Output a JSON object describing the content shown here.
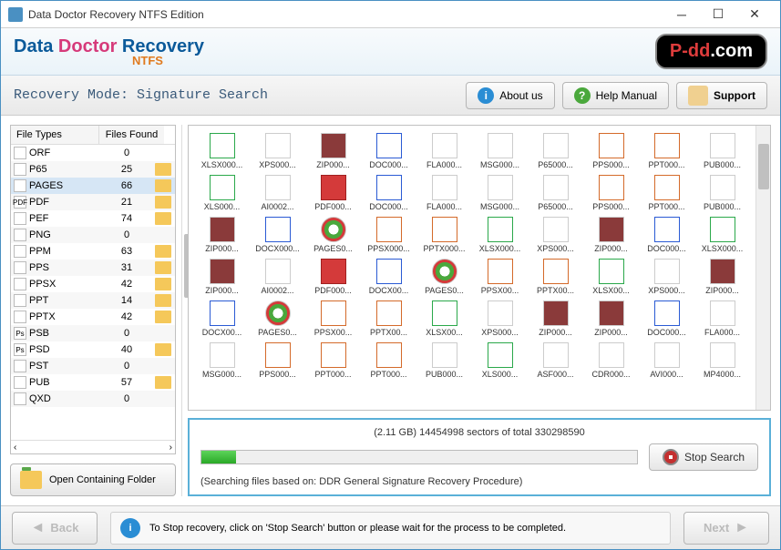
{
  "titlebar": {
    "text": "Data Doctor Recovery NTFS Edition"
  },
  "header": {
    "brand1": "Data ",
    "brand2": "Doctor",
    "brand3": " Recovery",
    "sub": "NTFS",
    "logo1": "P-dd",
    "logo2": ".com"
  },
  "modebar": {
    "mode": "Recovery Mode: Signature Search",
    "about": "About us",
    "help": "Help Manual",
    "support": "Support"
  },
  "types_header": {
    "name": "File Types",
    "count": "Files Found"
  },
  "types": [
    {
      "name": "ORF",
      "count": 0,
      "ic": "",
      "hasFolder": false
    },
    {
      "name": "P65",
      "count": 25,
      "ic": "",
      "hasFolder": true
    },
    {
      "name": "PAGES",
      "count": 66,
      "ic": "",
      "hasFolder": true,
      "sel": true
    },
    {
      "name": "PDF",
      "count": 21,
      "ic": "PDF",
      "hasFolder": true
    },
    {
      "name": "PEF",
      "count": 74,
      "ic": "",
      "hasFolder": true
    },
    {
      "name": "PNG",
      "count": 0,
      "ic": "",
      "hasFolder": false
    },
    {
      "name": "PPM",
      "count": 63,
      "ic": "",
      "hasFolder": true
    },
    {
      "name": "PPS",
      "count": 31,
      "ic": "",
      "hasFolder": true
    },
    {
      "name": "PPSX",
      "count": 42,
      "ic": "",
      "hasFolder": true
    },
    {
      "name": "PPT",
      "count": 14,
      "ic": "",
      "hasFolder": true
    },
    {
      "name": "PPTX",
      "count": 42,
      "ic": "",
      "hasFolder": true
    },
    {
      "name": "PSB",
      "count": 0,
      "ic": "Ps",
      "hasFolder": false
    },
    {
      "name": "PSD",
      "count": 40,
      "ic": "Ps",
      "hasFolder": true
    },
    {
      "name": "PST",
      "count": 0,
      "ic": "",
      "hasFolder": false
    },
    {
      "name": "PUB",
      "count": 57,
      "ic": "",
      "hasFolder": true
    },
    {
      "name": "QXD",
      "count": 0,
      "ic": "",
      "hasFolder": false
    }
  ],
  "open_btn": "Open Containing Folder",
  "files": [
    [
      {
        "l": "XLSX000...",
        "c": "c-xls"
      },
      {
        "l": "XPS000...",
        "c": "c-gen"
      },
      {
        "l": "ZIP000...",
        "c": "c-zip"
      },
      {
        "l": "DOC000...",
        "c": "c-doc"
      },
      {
        "l": "FLA000...",
        "c": "c-gen"
      },
      {
        "l": "MSG000...",
        "c": "c-gen"
      },
      {
        "l": "P65000...",
        "c": "c-gen"
      },
      {
        "l": "PPS000...",
        "c": "c-ppt"
      },
      {
        "l": "PPT000...",
        "c": "c-ppt"
      },
      {
        "l": "PUB000...",
        "c": "c-gen"
      }
    ],
    [
      {
        "l": "XLS000...",
        "c": "c-xls"
      },
      {
        "l": "AI0002...",
        "c": "c-gen"
      },
      {
        "l": "PDF000...",
        "c": "c-pdf"
      },
      {
        "l": "DOC000...",
        "c": "c-doc"
      },
      {
        "l": "FLA000...",
        "c": "c-gen"
      },
      {
        "l": "MSG000...",
        "c": "c-msg"
      },
      {
        "l": "P65000...",
        "c": "c-gen"
      },
      {
        "l": "PPS000...",
        "c": "c-ppt"
      },
      {
        "l": "PPT000...",
        "c": "c-ppt"
      },
      {
        "l": "PUB000...",
        "c": "c-gen"
      }
    ],
    [
      {
        "l": "ZIP000...",
        "c": "c-zip"
      },
      {
        "l": "DOCX000...",
        "c": "c-doc"
      },
      {
        "l": "PAGES0...",
        "c": "c-chr"
      },
      {
        "l": "PPSX000...",
        "c": "c-ppt"
      },
      {
        "l": "PPTX000...",
        "c": "c-ppt"
      },
      {
        "l": "XLSX000...",
        "c": "c-xls"
      },
      {
        "l": "XPS000...",
        "c": "c-gen"
      },
      {
        "l": "ZIP000...",
        "c": "c-zip"
      },
      {
        "l": "DOC000...",
        "c": "c-doc"
      },
      {
        "l": "XLSX000...",
        "c": "c-xls"
      }
    ],
    [
      {
        "l": "ZIP000...",
        "c": "c-zip"
      },
      {
        "l": "AI0002...",
        "c": "c-gen"
      },
      {
        "l": "PDF000...",
        "c": "c-pdf"
      },
      {
        "l": "DOCX00...",
        "c": "c-doc"
      },
      {
        "l": "PAGES0...",
        "c": "c-chr"
      },
      {
        "l": "PPSX00...",
        "c": "c-ppt"
      },
      {
        "l": "PPTX00...",
        "c": "c-ppt"
      },
      {
        "l": "XLSX00...",
        "c": "c-xls"
      },
      {
        "l": "XPS000...",
        "c": "c-gen"
      },
      {
        "l": "ZIP000...",
        "c": "c-zip"
      }
    ],
    [
      {
        "l": "DOCX00...",
        "c": "c-doc"
      },
      {
        "l": "PAGES0...",
        "c": "c-chr"
      },
      {
        "l": "PPSX00...",
        "c": "c-ppt"
      },
      {
        "l": "PPTX00...",
        "c": "c-ppt"
      },
      {
        "l": "XLSX00...",
        "c": "c-xls"
      },
      {
        "l": "XPS000...",
        "c": "c-gen"
      },
      {
        "l": "ZIP000...",
        "c": "c-zip"
      },
      {
        "l": "ZIP000...",
        "c": "c-zip"
      },
      {
        "l": "DOC000...",
        "c": "c-doc"
      },
      {
        "l": "FLA000...",
        "c": "c-gen"
      }
    ],
    [
      {
        "l": "MSG000...",
        "c": "c-msg"
      },
      {
        "l": "PPS000...",
        "c": "c-ppt"
      },
      {
        "l": "PPT000...",
        "c": "c-ppt"
      },
      {
        "l": "PPT000...",
        "c": "c-ppt"
      },
      {
        "l": "PUB000...",
        "c": "c-gen"
      },
      {
        "l": "XLS000...",
        "c": "c-xls"
      },
      {
        "l": "ASF000...",
        "c": "c-gen"
      },
      {
        "l": "CDR000...",
        "c": "c-gen"
      },
      {
        "l": "AVI000...",
        "c": "c-gen"
      },
      {
        "l": "MP4000...",
        "c": "c-gen"
      }
    ]
  ],
  "progress": {
    "top": "(2.11 GB) 14454998  sectors  of  total  330298590",
    "bottom": "(Searching files based on:  DDR General Signature Recovery Procedure)",
    "stop": "Stop Search"
  },
  "footer": {
    "back": "Back",
    "next": "Next",
    "msg": "To Stop recovery, click on 'Stop Search' button or please wait for the process to be completed."
  }
}
